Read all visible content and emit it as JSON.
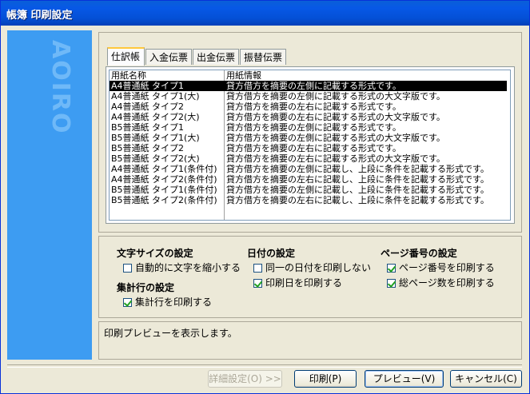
{
  "window": {
    "title": "帳簿 印刷設定"
  },
  "banner": {
    "logo_text": "AOIRO"
  },
  "tabs": [
    {
      "label": "仕訳帳",
      "active": true
    },
    {
      "label": "入金伝票",
      "active": false
    },
    {
      "label": "出金伝票",
      "active": false
    },
    {
      "label": "振替伝票",
      "active": false
    }
  ],
  "list": {
    "columns": [
      "用紙名称",
      "用紙情報"
    ],
    "rows": [
      {
        "name": "A4普通紙 タイプ1",
        "info": "貸方借方を摘要の左側に記載する形式です。",
        "selected": true
      },
      {
        "name": "A4普通紙 タイプ1(大)",
        "info": "貸方借方を摘要の左側に記載する形式の大文字版です。"
      },
      {
        "name": "A4普通紙 タイプ2",
        "info": "貸方借方を摘要の左右に記載する形式です。"
      },
      {
        "name": "A4普通紙 タイプ2(大)",
        "info": "貸方借方を摘要の左右に記載する形式の大文字版です。"
      },
      {
        "name": "B5普通紙 タイプ1",
        "info": "貸方借方を摘要の左側に記載する形式です。"
      },
      {
        "name": "B5普通紙 タイプ1(大)",
        "info": "貸方借方を摘要の左側に記載する形式の大文字版です。"
      },
      {
        "name": "B5普通紙 タイプ2",
        "info": "貸方借方を摘要の左右に記載する形式です。"
      },
      {
        "name": "B5普通紙 タイプ2(大)",
        "info": "貸方借方を摘要の左右に記載する形式の大文字版です。"
      },
      {
        "name": "A4普通紙 タイプ1(条件付)",
        "info": "貸方借方を摘要の左側に記載し、上段に条件を記載する形式です。"
      },
      {
        "name": "A4普通紙 タイプ2(条件付)",
        "info": "貸方借方を摘要の左右に記載し、上段に条件を記載する形式です。"
      },
      {
        "name": "B5普通紙 タイプ1(条件付)",
        "info": "貸方借方を摘要の左側に記載し、上段に条件を記載する形式です。"
      },
      {
        "name": "B5普通紙 タイプ2(条件付)",
        "info": "貸方借方を摘要の左右に記載し、上段に条件を記載する形式です。"
      }
    ]
  },
  "settings": {
    "font_size": {
      "title": "文字サイズの設定",
      "options": [
        {
          "label": "自動的に文字を縮小する",
          "checked": false
        }
      ]
    },
    "total_row": {
      "title": "集計行の設定",
      "options": [
        {
          "label": "集計行を印刷する",
          "checked": true
        }
      ]
    },
    "date": {
      "title": "日付の設定",
      "options": [
        {
          "label": "同一の日付を印刷しない",
          "checked": false
        },
        {
          "label": "印刷日を印刷する",
          "checked": true
        }
      ]
    },
    "page_number": {
      "title": "ページ番号の設定",
      "options": [
        {
          "label": "ページ番号を印刷する",
          "checked": true
        },
        {
          "label": "総ページ数を印刷する",
          "checked": true
        }
      ]
    }
  },
  "status": {
    "text": "印刷プレビューを表示します。"
  },
  "buttons": {
    "details": "詳細設定(O) >>",
    "print": "印刷(P)",
    "preview": "プレビュー(V)",
    "cancel": "キャンセル(C)"
  },
  "colors": {
    "title_bar": "#0450d6",
    "banner": "#3d9cf2",
    "selection": "#000000"
  }
}
